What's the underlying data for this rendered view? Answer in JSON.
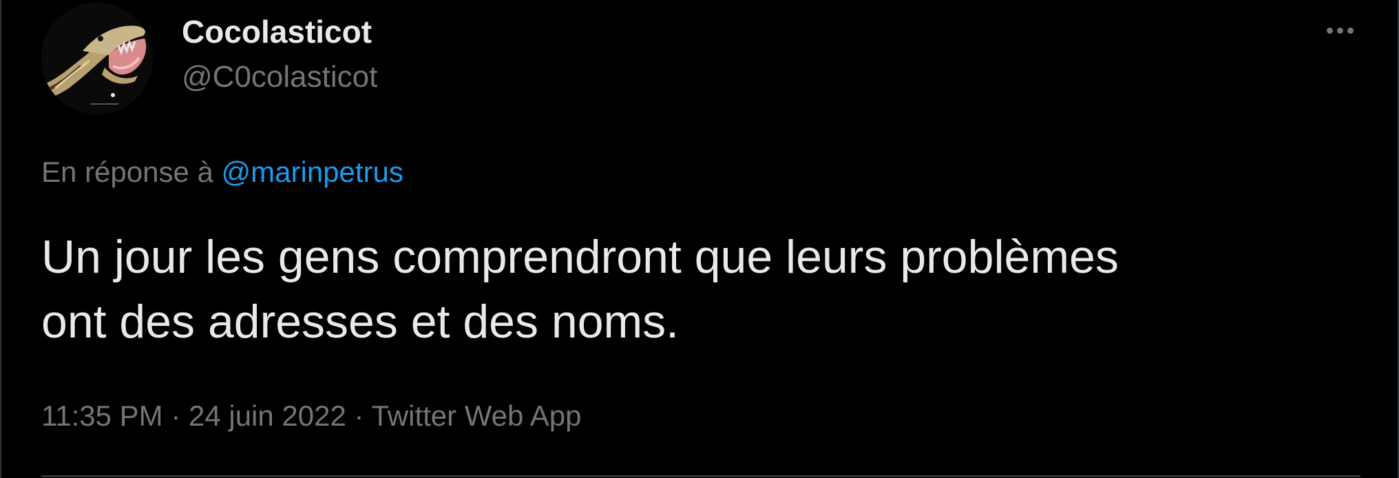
{
  "author": {
    "display_name": "Cocolasticot",
    "handle": "@C0colasticot",
    "avatar_icon": "snake-avatar"
  },
  "actions": {
    "more_icon": "more-dots-icon"
  },
  "reply": {
    "prefix": "En réponse à ",
    "mention": "@marinpetrus"
  },
  "tweet": {
    "lines": [
      "Un jour les gens comprendront que leurs problèmes",
      "ont des adresses et des noms."
    ]
  },
  "meta": {
    "time": "11:35 PM",
    "separator": " · ",
    "date": "24 juin 2022",
    "source": "Twitter Web App"
  },
  "colors": {
    "background": "#000000",
    "text_primary": "#e7e9ea",
    "text_secondary": "#71767b",
    "accent": "#1d9bf0",
    "border": "#2f3336"
  }
}
